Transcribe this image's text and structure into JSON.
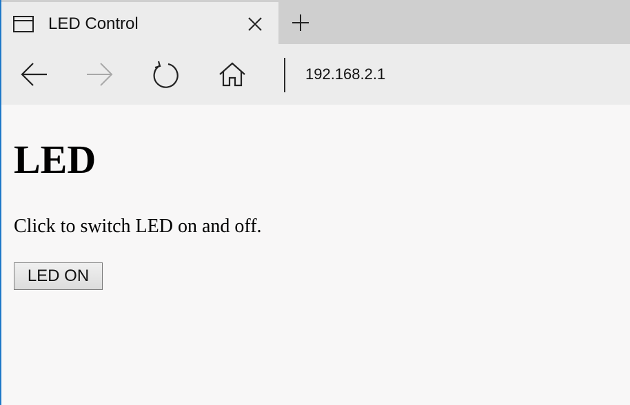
{
  "tab": {
    "title": "LED Control",
    "icon": "browser-tab-icon",
    "close_icon": "close-icon",
    "new_tab_icon": "plus-icon"
  },
  "navbar": {
    "back_icon": "back-arrow-icon",
    "forward_icon": "forward-arrow-icon",
    "refresh_icon": "refresh-icon",
    "home_icon": "home-icon",
    "address": "192.168.2.1"
  },
  "page": {
    "heading": "LED",
    "text": "Click to switch LED on and off.",
    "button_label": "LED ON"
  },
  "colors": {
    "window_border": "#1e78c8",
    "tab_active": "#ececec",
    "tabstrip": "#cfcfcf",
    "page_bg": "#f8f7f7"
  }
}
